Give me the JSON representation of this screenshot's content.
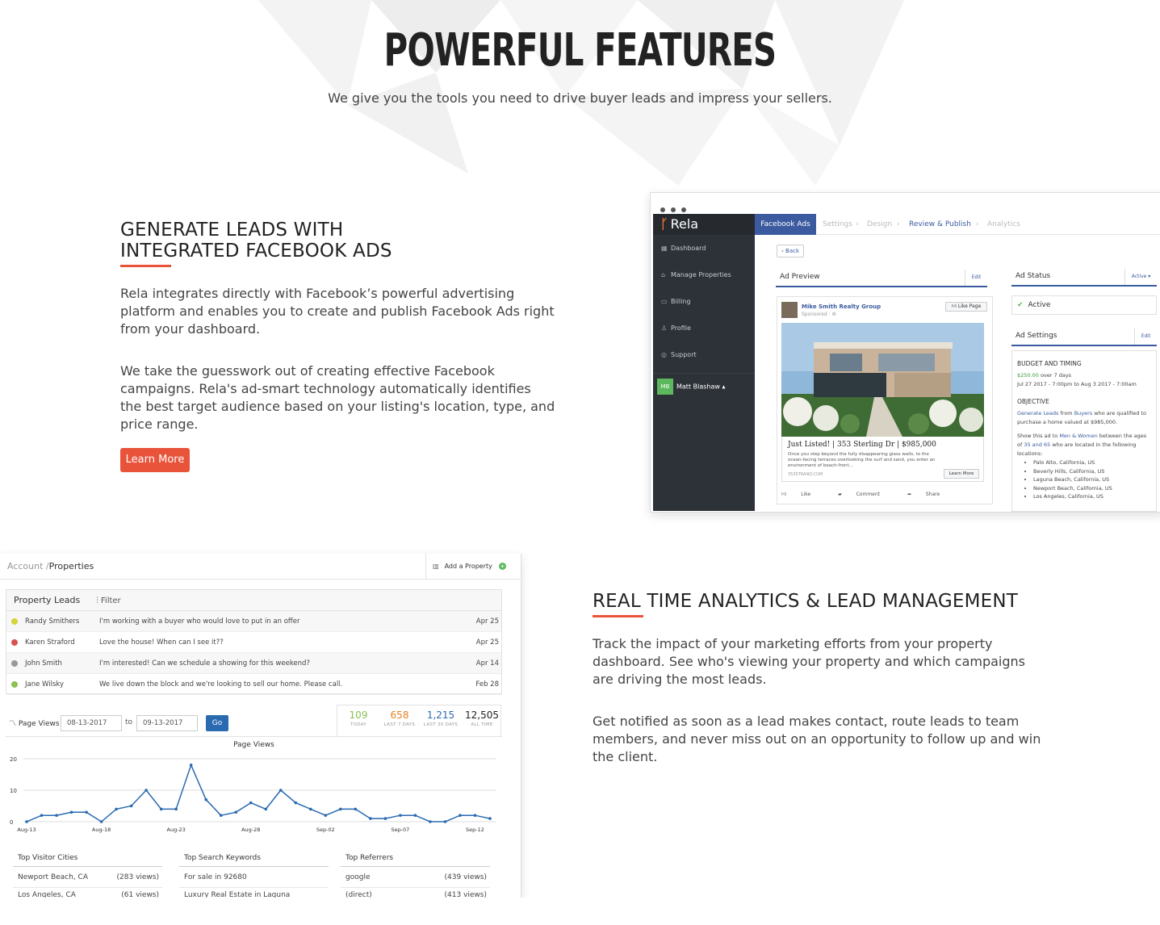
{
  "hero": {
    "title": "POWERFUL FEATURES",
    "subtitle": "We give you the tools you need to drive buyer leads and impress your sellers."
  },
  "feature1": {
    "heading_line1": "GENERATE LEADS WITH",
    "heading_line2": "INTEGRATED FACEBOOK ADS",
    "para1": "Rela integrates directly with Facebook’s powerful advertising platform and enables you to create and publish Facebook Ads right from your dashboard.",
    "para2": "We take the guesswork out of creating effective Facebook campaigns. Rela's ad-smart technology automatically identifies the best target audience based on your listing's location, type, and price range.",
    "button": "Learn More"
  },
  "feature2": {
    "heading": "REAL TIME ANALYTICS & LEAD MANAGEMENT",
    "para1": "Track the impact of your marketing efforts from your property dashboard. See who's viewing your property and which campaigns are driving the most leads.",
    "para2": "Get notified as soon as a lead makes contact, route leads to team members, and never miss out on an opportunity to follow up and win the client."
  },
  "accent_color": "#e8533a",
  "fb_screenshot": {
    "brand": "Rela",
    "sidebar": [
      {
        "icon": "dashboard-icon",
        "glyph": "▦",
        "label": "Dashboard"
      },
      {
        "icon": "home-icon",
        "glyph": "⌂",
        "label": "Manage Properties"
      },
      {
        "icon": "billing-icon",
        "glyph": "▭",
        "label": "Billing"
      },
      {
        "icon": "user-icon",
        "glyph": "♙",
        "label": "Profile"
      },
      {
        "icon": "support-icon",
        "glyph": "◎",
        "label": "Support"
      }
    ],
    "user_initials": "MB",
    "user_name": "Matt Blashaw ▴",
    "tabs": {
      "active": "Facebook Ads",
      "settings": "Settings",
      "design": "Design",
      "review": "Review & Publish",
      "analytics": "Analytics"
    },
    "back": "Back",
    "ad_preview": "Ad Preview",
    "edit": "Edit",
    "ad_status": "Ad Status",
    "status_dropdown": "Active ▾",
    "status_value": "Active",
    "ad_settings": "Ad Settings",
    "fb_post": {
      "page_name": "Mike Smith Realty Group",
      "sponsored": "Sponsored · ⚙",
      "like_page": "Like Page",
      "headline": "Just Listed! | 353 Sterling Dr | $985,000",
      "description": "Once you step beyond the fully disappearing glass walls, to the ocean-facing terraces overlooking the surf and sand, you enter an environment of beach-front...",
      "url": "353STRANO.COM",
      "cta": "Learn More",
      "like": "Like",
      "comment": "Comment",
      "share": "Share"
    },
    "settings": {
      "budget_heading": "BUDGET AND TIMING",
      "budget_amount": "$250.00",
      "budget_rest": " over 7 days",
      "timing": "Jul 27 2017 - 7:00pm to Aug 3 2017 - 7:00am",
      "objective_heading": "OBJECTIVE",
      "obj_a": "Generate Leads",
      "obj_b": " from ",
      "obj_c": "Buyers",
      "obj_d": " who are qualified to purchase a home valued at $985,000.",
      "show_a": "Show this ad to ",
      "show_b": "Men & Women",
      "show_c": " between the ages of ",
      "show_d": "35 and 65",
      "show_e": " who are located in the following locations:",
      "locations": [
        "Palo Alto, California, US",
        "Beverly Hills, California, US",
        "Laguna Beach, California, US",
        "Newport Beach, California, US",
        "Los Angeles, California, US"
      ]
    }
  },
  "property_screenshot": {
    "crumb_root": "Account /",
    "crumb_current": "Properties",
    "add_property": "Add a Property",
    "leads_title": "Property Leads",
    "filter": "Filter",
    "leads": [
      {
        "name": "Randy Smithers",
        "message": "I'm working with a buyer who would love to put in an offer",
        "date": "Apr 25",
        "color": "#d4d43a"
      },
      {
        "name": "Karen Straford",
        "message": "Love the house! When can I see it??",
        "date": "Apr 25",
        "color": "#d9534f"
      },
      {
        "name": "John Smith",
        "message": "I'm interested! Can we schedule a showing for this weekend?",
        "date": "Apr 14",
        "color": "#999999"
      },
      {
        "name": "Jane Wilsky",
        "message": "We live down the block and we're looking to sell our home. Please call.",
        "date": "Feb 28",
        "color": "#8cc152"
      }
    ],
    "page_views_label": "Page Views",
    "date_from": "08-13-2017",
    "date_to_label": "to",
    "date_to": "09-13-2017",
    "go": "Go",
    "stats": [
      {
        "value": "109",
        "label": "TODAY",
        "color": "#8cc152"
      },
      {
        "value": "658",
        "label": "LAST 7 DAYS",
        "color": "#e67e22"
      },
      {
        "value": "1,215",
        "label": "LAST 30 DAYS",
        "color": "#2a6ab0"
      },
      {
        "value": "12,505",
        "label": "ALL TIME",
        "color": "#222222"
      }
    ],
    "tables": [
      {
        "title": "Top Visitor Cities",
        "rows": [
          {
            "k": "Newport Beach, CA",
            "v": "(283 views)"
          },
          {
            "k": "Los Angeles, CA",
            "v": "(61 views)"
          }
        ]
      },
      {
        "title": "Top Search Keywords",
        "rows": [
          {
            "k": "For sale in 92680",
            "v": ""
          },
          {
            "k": "Luxury Real Estate in Laguna",
            "v": ""
          }
        ]
      },
      {
        "title": "Top Referrers",
        "rows": [
          {
            "k": "google",
            "v": "(439 views)"
          },
          {
            "k": "(direct)",
            "v": "(413 views)"
          }
        ]
      }
    ]
  },
  "chart_data": {
    "type": "line",
    "title": "Page Views",
    "x": [
      "Aug-13",
      "Aug-14",
      "Aug-15",
      "Aug-16",
      "Aug-17",
      "Aug-18",
      "Aug-19",
      "Aug-20",
      "Aug-21",
      "Aug-22",
      "Aug-23",
      "Aug-24",
      "Aug-25",
      "Aug-26",
      "Aug-27",
      "Aug-28",
      "Aug-29",
      "Aug-30",
      "Aug-31",
      "Sep-01",
      "Sep-02",
      "Sep-03",
      "Sep-04",
      "Sep-05",
      "Sep-06",
      "Sep-07",
      "Sep-08",
      "Sep-09",
      "Sep-10",
      "Sep-11",
      "Sep-12",
      "Sep-13"
    ],
    "tick_labels": [
      "Aug-13",
      "Aug-18",
      "Aug-23",
      "Aug-28",
      "Sep-02",
      "Sep-07",
      "Sep-12"
    ],
    "series": [
      {
        "values": [
          0,
          2,
          2,
          3,
          3,
          0,
          4,
          5,
          10,
          4,
          4,
          18,
          7,
          2,
          3,
          6,
          4,
          10,
          6,
          4,
          2,
          4,
          4,
          1,
          1,
          2,
          2,
          0,
          0,
          2,
          2,
          1
        ]
      }
    ],
    "yticks": [
      0,
      10,
      20
    ],
    "ylim": [
      0,
      20
    ],
    "grid": true,
    "line_color": "#2a6ab0"
  }
}
